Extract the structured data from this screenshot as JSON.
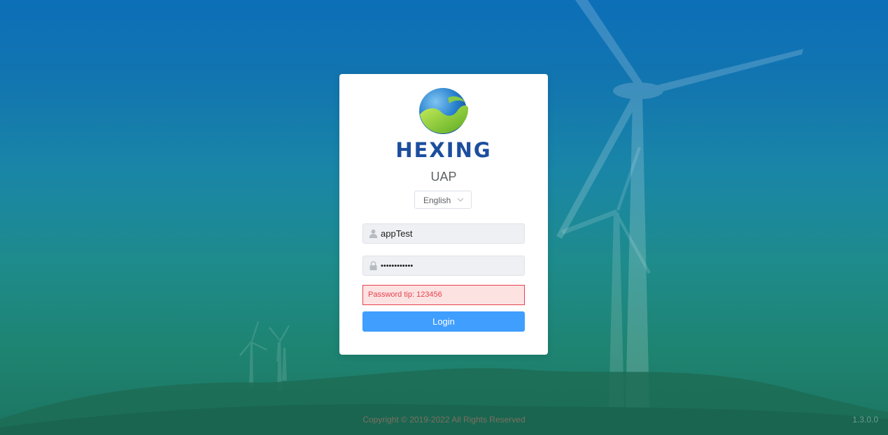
{
  "brand": {
    "name": "HEXING",
    "app_name": "UAP"
  },
  "language": {
    "selected": "English"
  },
  "login_form": {
    "username_value": "appTest",
    "password_value": "••••••••••••",
    "password_tip": "Password tip: 123456",
    "login_label": "Login"
  },
  "footer": {
    "copyright": "Copyright © 2019-2022 All Rights Reserved",
    "version": "1.3.0.0"
  },
  "icons": {
    "user": "user-icon",
    "lock": "lock-icon",
    "chevron": "chevron-down-icon"
  },
  "colors": {
    "brand_blue": "#1d4e9e",
    "primary_button": "#409eff",
    "error_red": "#e5424d",
    "error_bg": "#fde2e2"
  }
}
